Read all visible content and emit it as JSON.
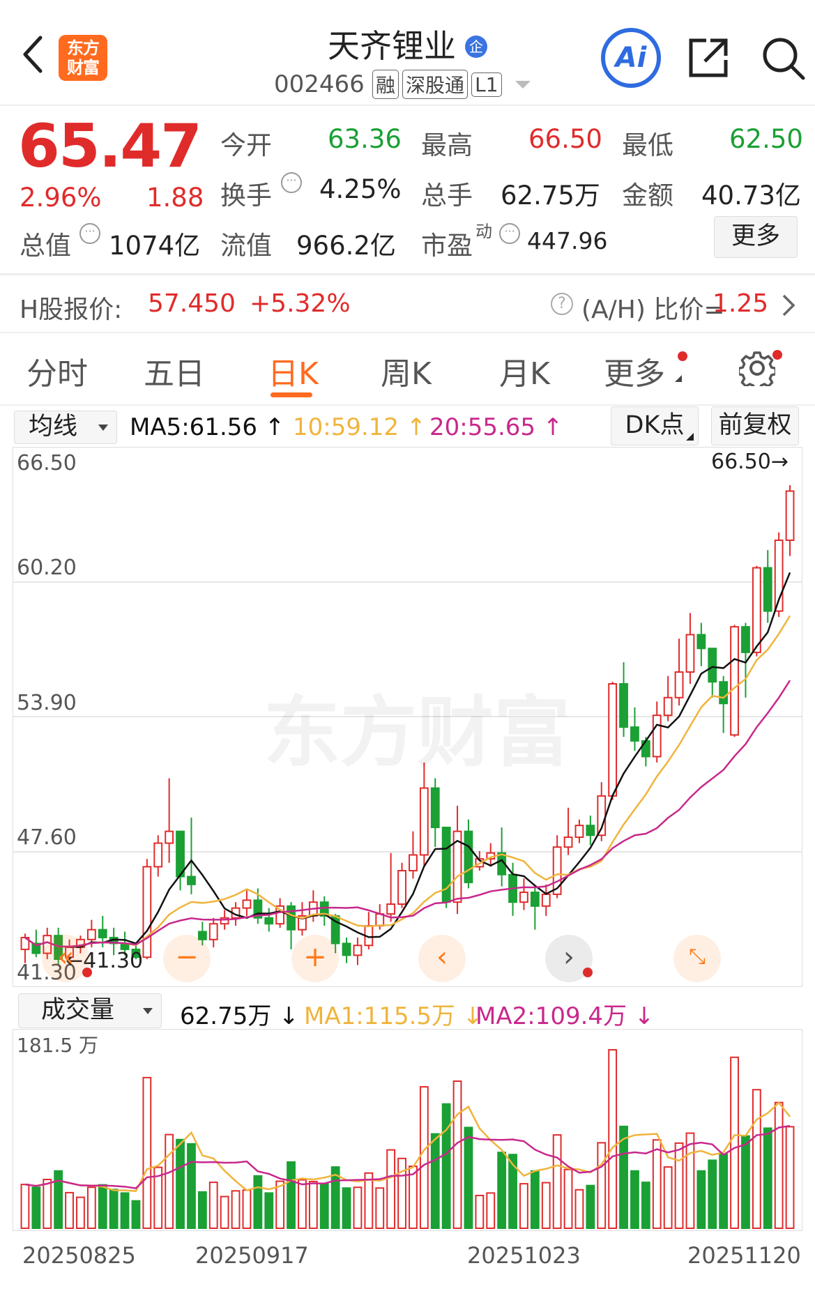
{
  "header": {
    "app_logo_text": "东方财富",
    "stock_name": "天齐锂业",
    "stock_code": "002466",
    "enterprise_badge": "企",
    "tags": [
      "融",
      "深股通",
      "L1"
    ],
    "ai_label": "Ai"
  },
  "quote": {
    "price": "65.47",
    "change_pct": "2.96%",
    "change_amt": "1.88",
    "fields": [
      {
        "label": "今开",
        "value": "63.36",
        "color": "green"
      },
      {
        "label": "最高",
        "value": "66.50",
        "color": "red"
      },
      {
        "label": "最低",
        "value": "62.50",
        "color": "green"
      },
      {
        "label": "换手",
        "value": "4.25%",
        "color": "dark"
      },
      {
        "label": "总手",
        "value": "62.75万",
        "color": "dark"
      },
      {
        "label": "金额",
        "value": "40.73亿",
        "color": "dark"
      },
      {
        "label": "总值",
        "value": "1074亿",
        "color": "dark"
      },
      {
        "label": "流值",
        "value": "966.2亿",
        "color": "dark"
      },
      {
        "label": "市盈",
        "value": "447.96",
        "color": "dark"
      }
    ],
    "pe_superscript": "动",
    "more_button": "更多"
  },
  "hshare": {
    "label": "H股报价:",
    "price": "57.450",
    "change": "+5.32%",
    "ratio_label": "(A/H) 比价=",
    "ratio_value": "1.25"
  },
  "tabs": [
    "分时",
    "五日",
    "日K",
    "周K",
    "月K",
    "更多"
  ],
  "active_tab": "日K",
  "ma_bar": {
    "selector": "均线",
    "ma5": "MA5:61.56",
    "ma10": "10:59.12",
    "ma20": "20:55.65",
    "dk_button": "DK点",
    "adjust_button": "前复权"
  },
  "price_chart": {
    "y_labels": [
      "66.50",
      "60.20",
      "53.90",
      "47.60",
      "41.30"
    ],
    "max_marker": "66.50",
    "min_marker": "41.30",
    "watermark": "东方财富"
  },
  "volume_bar": {
    "selector": "成交量",
    "vol": "62.75万",
    "ma1": "MA1:115.5万",
    "ma2": "MA2:109.4万",
    "y_label": "181.5 万"
  },
  "x_labels": [
    "20250825",
    "20250917",
    "20251023",
    "20251120"
  ],
  "colors": {
    "up": "#e02b2b",
    "down": "#1aa034",
    "ma5": "#111111",
    "ma10": "#f0b43c",
    "ma20": "#c8288c",
    "accent": "#ff7a1a"
  },
  "chart_data": {
    "type": "candlestick",
    "ylim": [
      41.3,
      66.5
    ],
    "candles": [
      [
        41.8,
        42.4,
        41.1,
        42.6
      ],
      [
        42.1,
        41.6,
        41.4,
        42.8
      ],
      [
        41.6,
        42.5,
        41.3,
        42.9
      ],
      [
        42.5,
        41.3,
        41.0,
        42.9
      ],
      [
        41.4,
        41.9,
        41.2,
        42.3
      ],
      [
        41.9,
        42.3,
        41.6,
        42.5
      ],
      [
        42.3,
        42.8,
        41.9,
        43.3
      ],
      [
        42.8,
        42.4,
        41.9,
        43.5
      ],
      [
        42.4,
        42.1,
        41.5,
        42.9
      ],
      [
        42.1,
        41.8,
        41.5,
        42.7
      ],
      [
        41.8,
        41.4,
        41.3,
        42.0
      ],
      [
        41.4,
        46.0,
        41.3,
        46.4
      ],
      [
        46.0,
        47.2,
        45.5,
        47.6
      ],
      [
        47.2,
        47.8,
        46.2,
        50.5
      ],
      [
        47.8,
        45.5,
        44.8,
        47.8
      ],
      [
        45.5,
        45.1,
        44.6,
        48.5
      ],
      [
        42.7,
        42.3,
        42.0,
        43.2
      ],
      [
        42.3,
        43.1,
        41.9,
        43.4
      ],
      [
        43.1,
        43.4,
        42.8,
        43.8
      ],
      [
        43.4,
        43.9,
        43.0,
        44.2
      ],
      [
        43.9,
        44.3,
        43.5,
        44.8
      ],
      [
        44.3,
        43.4,
        43.1,
        44.9
      ],
      [
        43.4,
        43.1,
        42.7,
        43.9
      ],
      [
        43.1,
        44.0,
        42.9,
        44.4
      ],
      [
        44.0,
        42.8,
        41.8,
        44.2
      ],
      [
        42.8,
        43.5,
        42.5,
        44.2
      ],
      [
        43.5,
        44.2,
        43.2,
        44.8
      ],
      [
        44.2,
        43.5,
        43.0,
        44.5
      ],
      [
        43.5,
        42.1,
        41.6,
        43.6
      ],
      [
        42.1,
        41.5,
        41.1,
        42.4
      ],
      [
        41.5,
        42.0,
        41.0,
        42.4
      ],
      [
        42.0,
        43.0,
        41.8,
        43.7
      ],
      [
        43.0,
        43.6,
        42.8,
        44.1
      ],
      [
        43.6,
        44.1,
        43.2,
        46.7
      ],
      [
        44.1,
        45.8,
        43.9,
        46.2
      ],
      [
        45.8,
        46.6,
        45.4,
        47.8
      ],
      [
        46.6,
        50.0,
        46.0,
        51.3
      ],
      [
        50.0,
        48.0,
        47.0,
        50.5
      ],
      [
        48.0,
        44.2,
        43.9,
        48.0
      ],
      [
        44.2,
        47.8,
        43.6,
        49.1
      ],
      [
        47.8,
        45.2,
        44.9,
        48.4
      ],
      [
        46.0,
        46.4,
        45.8,
        46.8
      ],
      [
        46.4,
        46.7,
        46.0,
        47.2
      ],
      [
        46.7,
        45.6,
        45.0,
        48.0
      ],
      [
        45.6,
        44.2,
        43.5,
        46.2
      ],
      [
        44.2,
        44.7,
        43.8,
        45.4
      ],
      [
        44.7,
        44.0,
        42.8,
        45.0
      ],
      [
        44.0,
        44.6,
        43.5,
        45.1
      ],
      [
        44.6,
        47.0,
        44.4,
        47.6
      ],
      [
        47.0,
        47.5,
        46.6,
        49.0
      ],
      [
        47.5,
        48.1,
        47.2,
        48.4
      ],
      [
        48.1,
        47.6,
        47.1,
        48.6
      ],
      [
        47.6,
        49.6,
        47.3,
        50.3
      ],
      [
        49.6,
        55.3,
        49.4,
        55.4
      ],
      [
        55.3,
        53.1,
        52.6,
        56.4
      ],
      [
        53.1,
        52.4,
        51.9,
        54.1
      ],
      [
        52.4,
        51.6,
        51.1,
        52.6
      ],
      [
        51.6,
        53.7,
        51.3,
        54.4
      ],
      [
        53.7,
        54.6,
        53.4,
        55.7
      ],
      [
        54.6,
        55.9,
        54.2,
        57.6
      ],
      [
        55.9,
        57.8,
        55.3,
        58.9
      ],
      [
        57.8,
        57.1,
        56.2,
        58.4
      ],
      [
        57.1,
        55.4,
        54.6,
        56.8
      ],
      [
        55.4,
        54.3,
        52.8,
        55.7
      ],
      [
        52.7,
        58.2,
        52.6,
        58.3
      ],
      [
        58.2,
        56.9,
        54.6,
        58.4
      ],
      [
        56.9,
        61.2,
        56.7,
        61.3
      ],
      [
        61.2,
        59.0,
        58.4,
        62.1
      ],
      [
        59.0,
        62.6,
        58.7,
        63.0
      ],
      [
        62.6,
        65.1,
        61.8,
        65.4
      ]
    ]
  }
}
